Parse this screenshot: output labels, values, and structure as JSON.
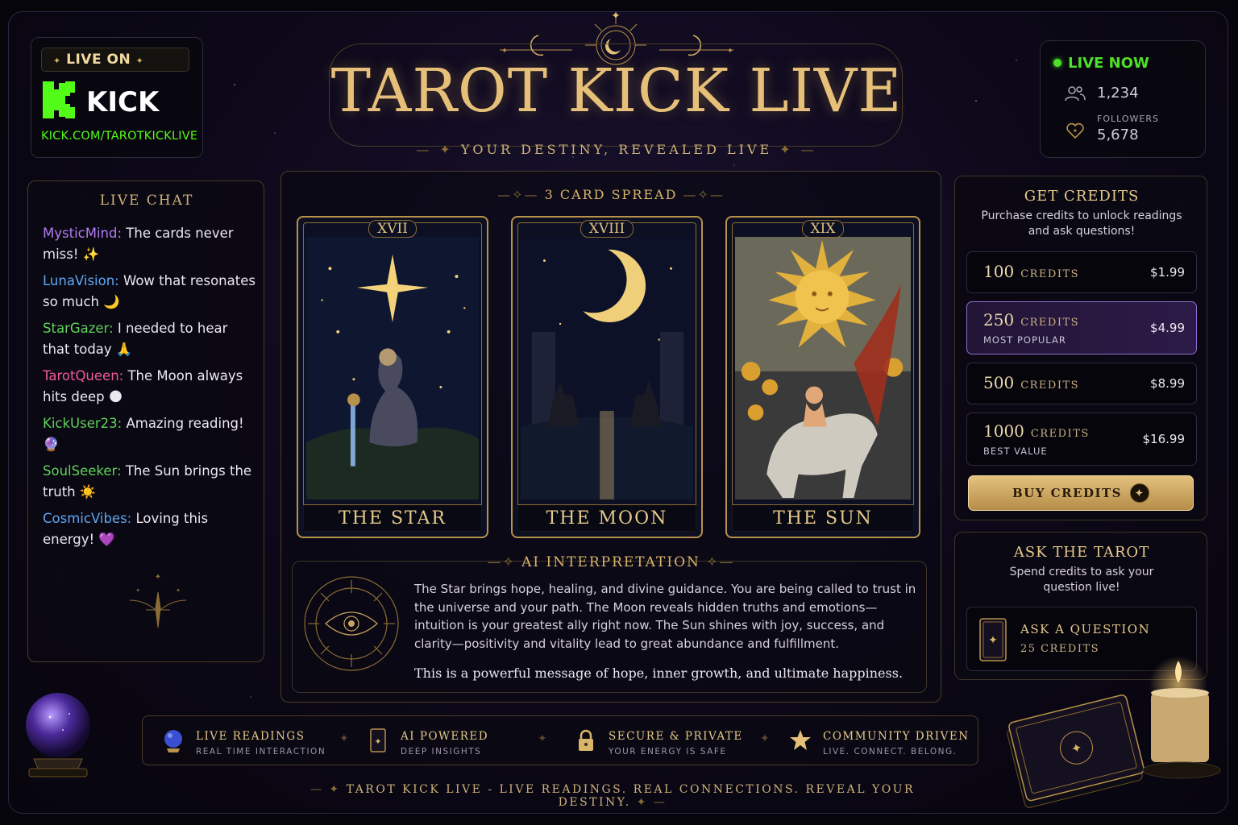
{
  "header": {
    "live_on": "LIVE ON",
    "kick_brand": "KICK",
    "kick_url": "KICK.COM/TAROTKICKLIVE",
    "title": "TAROT KICK LIVE",
    "subtitle": "YOUR DESTINY, REVEALED LIVE"
  },
  "stats": {
    "live_now": "LIVE NOW",
    "viewers": "1,234",
    "followers_label": "FOLLOWERS",
    "followers": "5,678"
  },
  "chat": {
    "title": "LIVE CHAT",
    "messages": [
      {
        "user": "MysticMind:",
        "text": "The cards never miss! ✨",
        "color": "#b07cf0"
      },
      {
        "user": "LunaVision:",
        "text": "Wow that resonates so much 🌙",
        "color": "#5fa8f5"
      },
      {
        "user": "StarGazer:",
        "text": "I needed to hear that today 🙏",
        "color": "#5fd35a"
      },
      {
        "user": "TarotQueen:",
        "text": "The Moon always hits deep 🌑",
        "color": "#f05a9a"
      },
      {
        "user": "KickUser23:",
        "text": "Amazing reading! 🔮",
        "color": "#5fd35a"
      },
      {
        "user": "SoulSeeker:",
        "text": "The Sun brings the truth ☀️",
        "color": "#5fd35a"
      },
      {
        "user": "CosmicVibes:",
        "text": "Loving this energy! 💜",
        "color": "#5fa8f5"
      }
    ]
  },
  "spread": {
    "label": "3 CARD SPREAD",
    "cards": [
      {
        "numeral": "XVII",
        "name": "THE STAR"
      },
      {
        "numeral": "XVIII",
        "name": "THE MOON"
      },
      {
        "numeral": "XIX",
        "name": "THE SUN"
      }
    ]
  },
  "interpretation": {
    "label": "AI INTERPRETATION",
    "body": "The Star brings hope, healing, and divine guidance. You are being called to trust  in the universe and your path. The Moon reveals hidden truths and emotions—intuition is your greatest ally right now. The Sun shines with joy, success, and clarity—positivity and vitality lead to great abundance and fulfillment.",
    "summary": "This is a powerful message of hope, inner growth, and ultimate happiness."
  },
  "credits": {
    "title": "GET CREDITS",
    "subtitle": "Purchase credits to unlock readings and ask questions!",
    "packs": [
      {
        "amount": "100",
        "word": "CREDITS",
        "tag": "",
        "price": "$1.99"
      },
      {
        "amount": "250",
        "word": "CREDITS",
        "tag": "MOST POPULAR",
        "price": "$4.99"
      },
      {
        "amount": "500",
        "word": "CREDITS",
        "tag": "",
        "price": "$8.99"
      },
      {
        "amount": "1000",
        "word": "CREDITS",
        "tag": "BEST VALUE",
        "price": "$16.99"
      }
    ],
    "buy_label": "BUY CREDITS"
  },
  "ask": {
    "title": "ASK THE TAROT",
    "subtitle": "Spend credits to ask your question live!",
    "button_label": "ASK A QUESTION",
    "button_cost": "25 CREDITS"
  },
  "features": [
    {
      "title": "LIVE READINGS",
      "sub": "REAL TIME INTERACTION",
      "icon": "crystal-ball-icon"
    },
    {
      "title": "AI POWERED",
      "sub": "DEEP INSIGHTS",
      "icon": "tarot-card-icon"
    },
    {
      "title": "SECURE & PRIVATE",
      "sub": "YOUR ENERGY IS SAFE",
      "icon": "lock-icon"
    },
    {
      "title": "COMMUNITY DRIVEN",
      "sub": "LIVE. CONNECT. BELONG.",
      "icon": "star-icon"
    }
  ],
  "footer": "TAROT KICK LIVE - LIVE READINGS. REAL CONNECTIONS. REVEAL YOUR DESTINY.",
  "colors": {
    "gold": "#d9b56a",
    "kick_green": "#53fc18",
    "live_green": "#4de02a",
    "popular_purple": "#8f6fcf"
  }
}
